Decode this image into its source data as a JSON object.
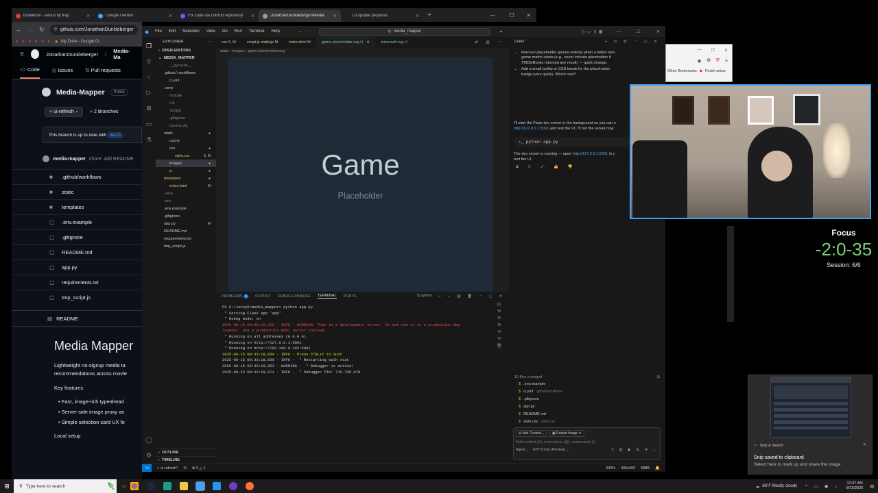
{
  "browser": {
    "tabs": [
      {
        "label": "boskence - venus fly trap",
        "color": "#e53935"
      },
      {
        "label": "Google Gemini",
        "color": "#42a5f5"
      },
      {
        "label": "Fix code via GitHub repository",
        "color": "#7c4dff"
      },
      {
        "label": "JonathanDunkleberger/Media",
        "color": "#9e9e9e"
      },
      {
        "label": "UI update proposal",
        "color": "#212121"
      }
    ],
    "url": "github.com/JonathanDunkleberger",
    "bookmark": "My Drive - Google Dr",
    "bookmarks_right": "Other Bookmarks",
    "finish_setup": "Finish setup"
  },
  "github": {
    "owner": "JonathanDunkleberger",
    "repo_short": "Media-Ma",
    "tabs": [
      "Code",
      "Issues",
      "Pull requests"
    ],
    "repo_title": "Media-Mapper",
    "visibility": "Public",
    "branch": "ui-refresh",
    "branches": "2 Branches",
    "uptodate": "This branch is up to date with",
    "main": "main",
    "commit_user": "media-mapper",
    "commit_msg": "chore: add README",
    "files": [
      {
        "name": ".github/workflows",
        "type": "folder"
      },
      {
        "name": "static",
        "type": "folder"
      },
      {
        "name": "templates",
        "type": "folder"
      },
      {
        "name": ".env.example",
        "type": "file"
      },
      {
        "name": ".gitignore",
        "type": "file"
      },
      {
        "name": "README.md",
        "type": "file"
      },
      {
        "name": "app.py",
        "type": "file"
      },
      {
        "name": "requirements.txt",
        "type": "file"
      },
      {
        "name": "tmp_script.js",
        "type": "file"
      }
    ],
    "readme_label": "README",
    "readme_title": "Media Mapper",
    "readme_p1": "Lightweight no-signup media ta",
    "readme_p1b": "recommendations across movie",
    "key_features": "Key features",
    "features": [
      "Fast, image-rich typeahead",
      "Server-side image proxy an",
      "Simple selection card UX fo"
    ],
    "local_setup": "Local setup"
  },
  "vscode": {
    "menu": [
      "File",
      "Edit",
      "Selection",
      "View",
      "Go",
      "Run",
      "Terminal",
      "Help"
    ],
    "search": "media_mapper",
    "explorer_title": "EXPLORER",
    "open_editors": "OPEN EDITORS",
    "root": "MEDIA_MAPPER",
    "tree": [
      {
        "name": "__pycache__",
        "indent": 2,
        "status": "",
        "color": "#8b8b8b"
      },
      {
        "name": ".github \\ workflows",
        "indent": 1,
        "status": "",
        "color": "#ccc"
      },
      {
        "name": "ci.yml",
        "indent": 2,
        "status": "",
        "color": "#ccc"
      },
      {
        "name": ".venv",
        "indent": 1,
        "status": "",
        "color": "#ccc"
      },
      {
        "name": "Include",
        "indent": 2,
        "status": "",
        "color": "#8b8b8b"
      },
      {
        "name": "Lib",
        "indent": 2,
        "status": "",
        "color": "#8b8b8b"
      },
      {
        "name": "Scripts",
        "indent": 2,
        "status": "",
        "color": "#8b8b8b"
      },
      {
        "name": ".gitignore",
        "indent": 2,
        "status": "",
        "color": "#8b8b8b"
      },
      {
        "name": "pyvenv.cfg",
        "indent": 2,
        "status": "",
        "color": "#8b8b8b"
      },
      {
        "name": "static",
        "indent": 1,
        "status": "●",
        "color": "#e2c08d"
      },
      {
        "name": "cache",
        "indent": 2,
        "status": "",
        "color": "#ccc"
      },
      {
        "name": "css",
        "indent": 2,
        "status": "●",
        "color": "#e2c08d"
      },
      {
        "name": "style.css",
        "indent": 3,
        "status": "5, M",
        "color": "#e2c08d"
      },
      {
        "name": "images",
        "indent": 2,
        "status": "●",
        "color": "#ccc"
      },
      {
        "name": "js",
        "indent": 2,
        "status": "●",
        "color": "#e2c08d"
      },
      {
        "name": "templates",
        "indent": 1,
        "status": "●",
        "color": "#e2c08d"
      },
      {
        "name": "index.html",
        "indent": 2,
        "status": "M",
        "color": "#e2c08d"
      },
      {
        "name": ".venv",
        "indent": 1,
        "status": "",
        "color": "#8b8b8b"
      },
      {
        "name": ".env",
        "indent": 1,
        "status": "",
        "color": "#8b8b8b"
      },
      {
        "name": ".env.example",
        "indent": 1,
        "status": "",
        "color": "#ccc"
      },
      {
        "name": ".gitignore",
        "indent": 1,
        "status": "",
        "color": "#ccc"
      },
      {
        "name": "app.py",
        "indent": 1,
        "status": "M",
        "color": "#e2c08d"
      },
      {
        "name": "README.md",
        "indent": 1,
        "status": "",
        "color": "#ccc"
      },
      {
        "name": "requirements.txt",
        "indent": 1,
        "status": "",
        "color": "#ccc"
      },
      {
        "name": "tmp_script.js",
        "indent": 1,
        "status": "",
        "color": "#ccc"
      }
    ],
    "outline": "OUTLINE",
    "timeline": "TIMELINE",
    "tabs": [
      {
        "label": "css 5, M",
        "active": false,
        "color": "#e2c08d"
      },
      {
        "label": "script.js static\\js M",
        "active": false,
        "color": "#e2c08d"
      },
      {
        "label": "index.html M",
        "active": false,
        "color": "#e2c08d"
      },
      {
        "label": "game-placeholder.svg U",
        "active": true,
        "color": "#73c991"
      },
      {
        "label": "minecraft.svg U",
        "active": false,
        "color": "#73c991"
      }
    ],
    "breadcrumb": "static › images › game-placeholder.svg",
    "canvas_title": "Game",
    "canvas_subtitle": "Placeholder",
    "panel_tabs": [
      "PROBLEMS",
      "OUTPUT",
      "DEBUG CONSOLE",
      "TERMINAL",
      "PORTS"
    ],
    "problems_count": "3",
    "terminal_shell": "python",
    "terminal_lines": [
      {
        "text": "PS G:\\JonnyD\\media_mapper> python app.py",
        "color": "#ccc"
      },
      {
        "text": " * Serving Flask app 'app'",
        "color": "#ccc"
      },
      {
        "text": " * Debug mode: on",
        "color": "#ccc"
      },
      {
        "text": "2025-08-15 00:33:18,029 - INFO - WARNING: This is a development server. Do not use it in a production dep",
        "color": "#f14c4c"
      },
      {
        "text": "loyment. Use a production WSGI server instead.",
        "color": "#f14c4c"
      },
      {
        "text": " * Running on all addresses (0.0.0.0)",
        "color": "#ccc"
      },
      {
        "text": " * Running on http://127.0.0.1:5001",
        "color": "#ccc"
      },
      {
        "text": " * Running on http://192.168.0.103:5001",
        "color": "#ccc"
      },
      {
        "text": "2025-08-15 00:33:18,034 - INFO - Press CTRL+C to quit",
        "color": "#e5e510"
      },
      {
        "text": "2025-08-15 00:33:18,039 - INFO -  * Restarting with stat",
        "color": "#ccc"
      },
      {
        "text": "2025-08-15 00:33:19,953 - WARNING -  * Debugger is active!",
        "color": "#ccc"
      },
      {
        "text": "2025-08-15 00:33:19,971 - INFO -  * Debugger PIN: 715-705-879",
        "color": "#ccc"
      }
    ],
    "status_branch": "ui-refresh*",
    "status_errors": "0 △ 1",
    "status_zoom": "200%",
    "status_dims": "400x600",
    "status_size": "588B"
  },
  "chat": {
    "title": "CHAT",
    "bullets": [
      "Remove placeholder games entirely when a better non-game match exists (e.g., never include placeholder if TMDb/Books returned any result) — quick change.",
      "Add a small tooltip or CSS tweak for the placeholder badge (very quick). Which next?"
    ],
    "msg1": "I'll start the Flask dev server in the background so you can o",
    "msg1_link": "http://127.0.0.1:5001",
    "msg1_rest": "and test the UI. I'll run the server now.",
    "cmd": "python app.py",
    "msg2": "The dev server is running — open",
    "msg2_link": "http://127.0.0.1:5001",
    "msg2_rest": "in y",
    "msg2_end": "test the UI.",
    "files_changed": "10 files changed",
    "changed_files": [
      {
        "name": ".env.example",
        "path": ""
      },
      {
        "name": "ci.yml",
        "path": ".github\\workflows"
      },
      {
        "name": ".gitignore",
        "path": ""
      },
      {
        "name": "app.py",
        "path": ""
      },
      {
        "name": "README.md",
        "path": ""
      },
      {
        "name": "style.css",
        "path": "static\\css"
      }
    ],
    "add_context": "Add Context...",
    "pasted_image": "Pasted Image",
    "input_placeholder": "Add context (#), extensions (@), commands (/)",
    "mode": "Agent",
    "model": "GPT-5 mini (Preview)"
  },
  "overlay": {
    "focus_label": "Focus",
    "timer": "-2:0-35",
    "session": "Session: 6/6",
    "snip_app": "Snip & Sketch",
    "snip_title": "Snip saved to clipboard",
    "snip_body": "Select here to mark up and share the image"
  },
  "taskbar": {
    "search_placeholder": "Type here to search",
    "weather": "86°F  Mostly cloudy",
    "time": "12:47 AM",
    "date": "8/15/2025"
  }
}
